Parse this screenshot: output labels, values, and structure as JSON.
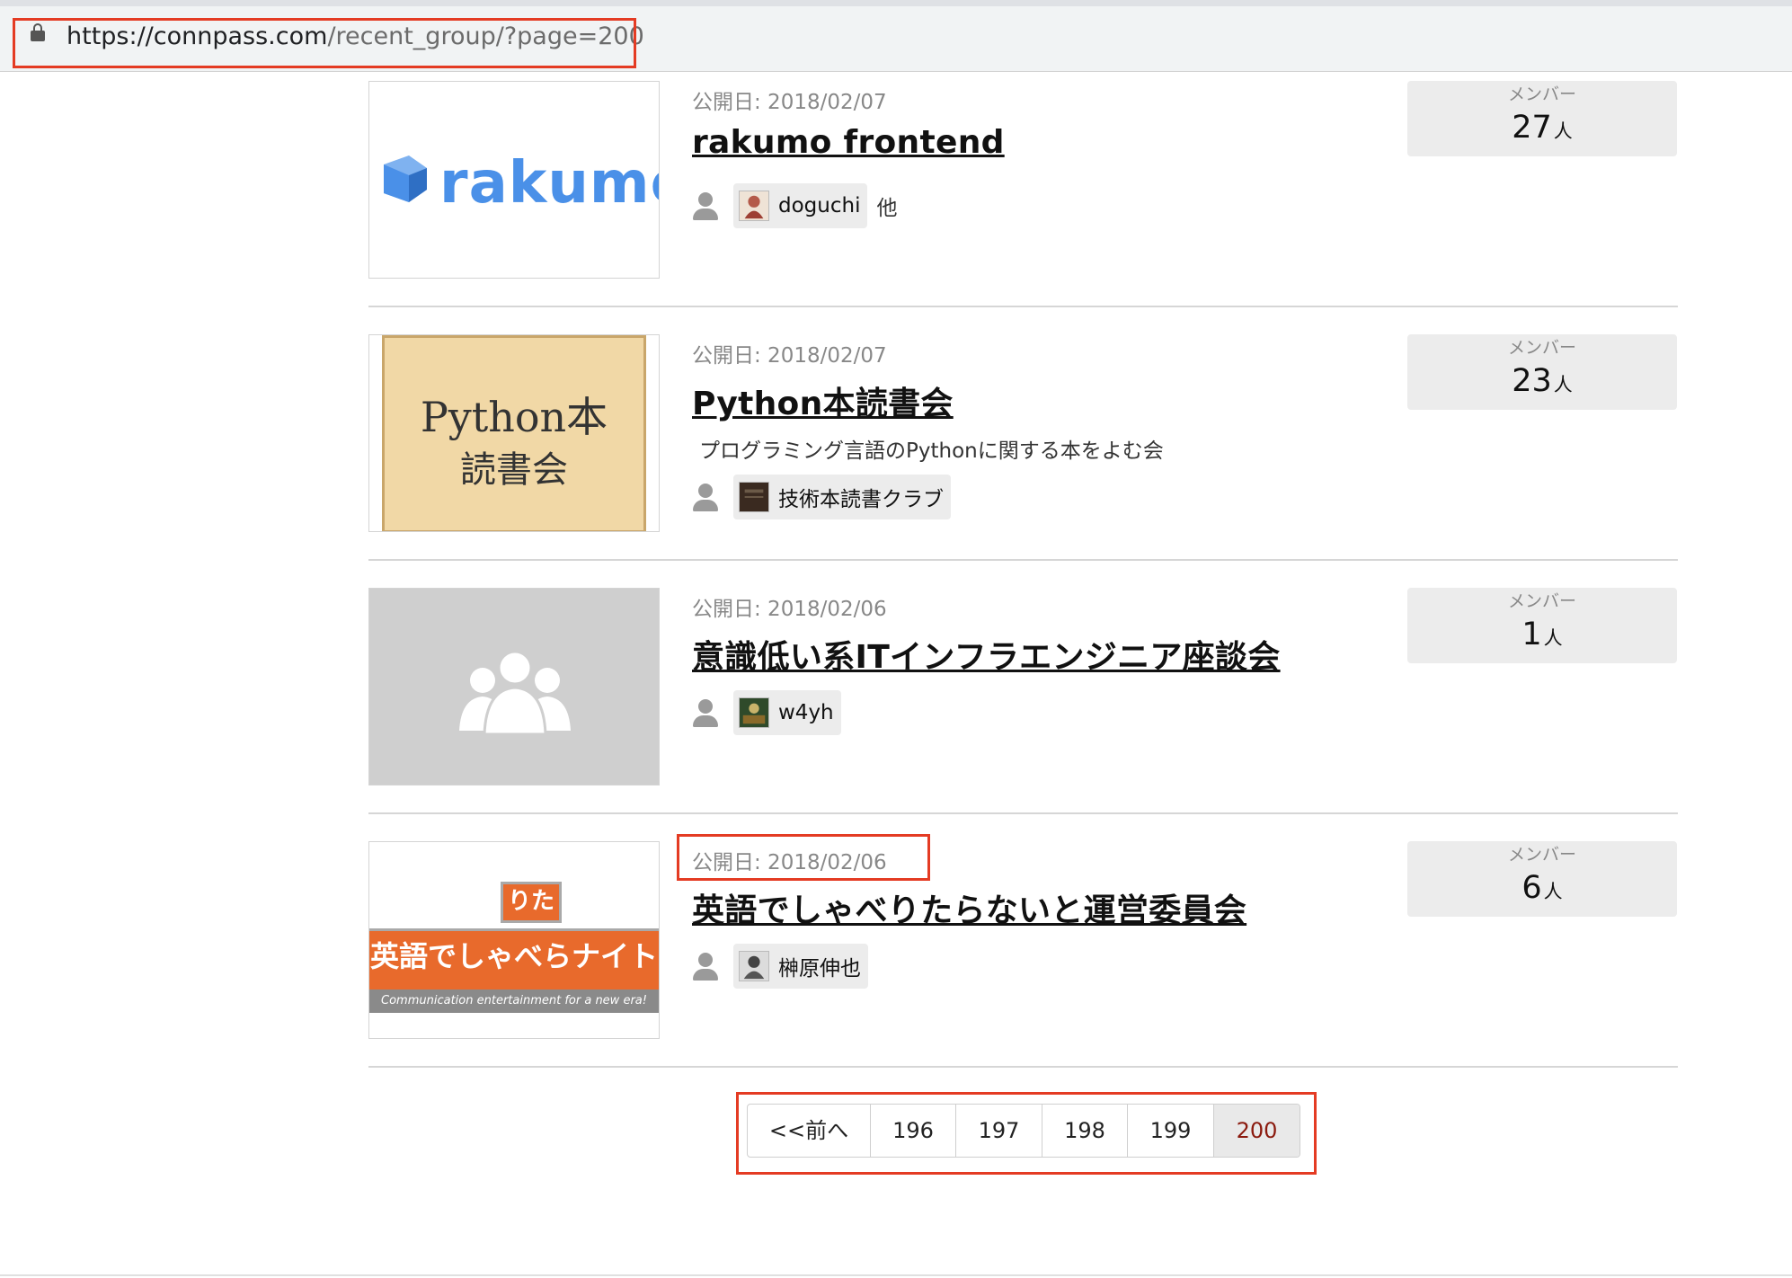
{
  "browser": {
    "url_host": "https://connpass.com",
    "url_path": "/recent_group/?page=200"
  },
  "groups": [
    {
      "published": "公開日: 2018/02/07",
      "title": "rakumo frontend",
      "description": "",
      "thumb_text": [
        "rakumo"
      ],
      "admin_name": "doguchi",
      "admin_more": "他",
      "member_label": "メンバー",
      "member_count": "27",
      "member_unit": "人"
    },
    {
      "published": "公開日: 2018/02/07",
      "title": "Python本読書会",
      "description": "プログラミング言語のPythonに関する本をよむ会",
      "thumb_text": [
        "Python本",
        "読書会"
      ],
      "admin_name": "技術本読書クラブ",
      "admin_more": "",
      "member_label": "メンバー",
      "member_count": "23",
      "member_unit": "人"
    },
    {
      "published": "公開日: 2018/02/06",
      "title": "意識低い系ITインフラエンジニア座談会",
      "description": "",
      "thumb_text": [],
      "admin_name": "w4yh",
      "admin_more": "",
      "member_label": "メンバー",
      "member_count": "1",
      "member_unit": "人"
    },
    {
      "published": "公開日: 2018/02/06",
      "title": "英語でしゃべりたらないと運営委員会",
      "description": "",
      "thumb_text": [
        "りた",
        "英語でしゃべらナイト",
        "Communication entertainment for a new era!"
      ],
      "admin_name": "榊原伸也",
      "admin_more": "",
      "member_label": "メンバー",
      "member_count": "6",
      "member_unit": "人"
    }
  ],
  "pagination": {
    "prev": "<<前へ",
    "pages": [
      "196",
      "197",
      "198",
      "199",
      "200"
    ],
    "current": "200"
  },
  "colors": {
    "annotation": "#e43b23",
    "current_page": "#8b1a0e",
    "rakumo_blue": "#4a90e8",
    "banner_orange": "#e86a2c"
  }
}
